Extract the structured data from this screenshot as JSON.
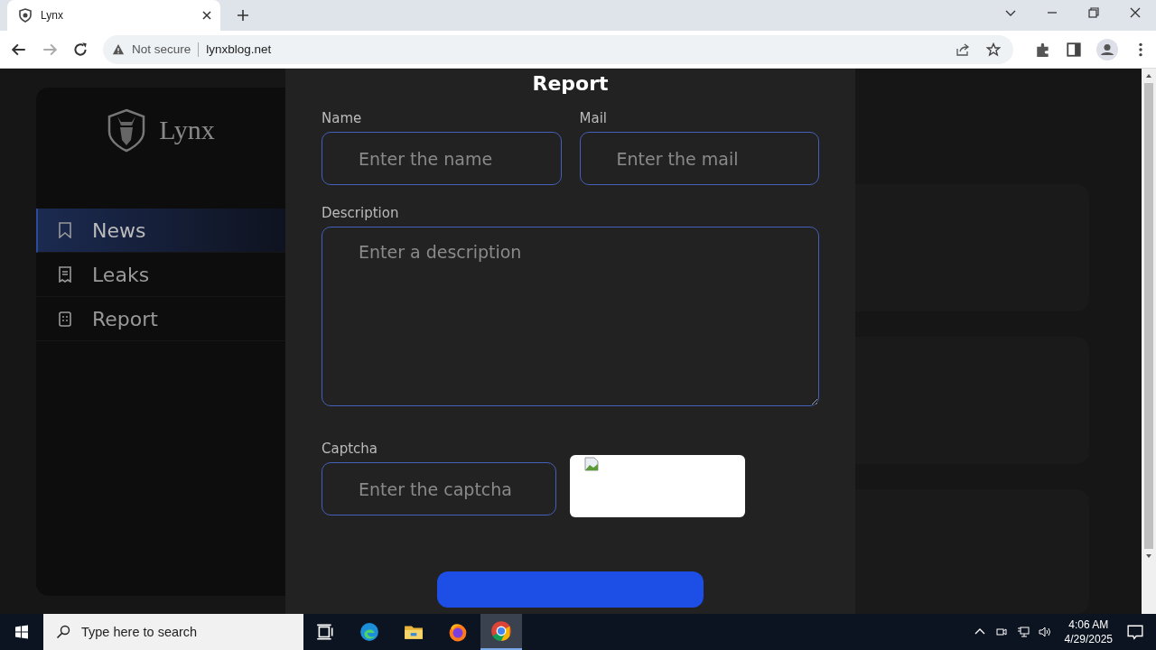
{
  "browser": {
    "tab": {
      "title": "Lynx"
    },
    "address": {
      "security": "Not secure",
      "url": "lynxblog.net"
    }
  },
  "sidebar": {
    "logo": "Lynx",
    "items": [
      {
        "label": "News",
        "selected": true,
        "kind": "bookmark"
      },
      {
        "label": "Leaks",
        "selected": false,
        "kind": "receipt"
      },
      {
        "label": "Report",
        "selected": false,
        "kind": "checklist"
      }
    ]
  },
  "form": {
    "title": "Report",
    "fields": [
      {
        "label": "Name",
        "placeholder": "Enter the name"
      },
      {
        "label": "Mail",
        "placeholder": "Enter the mail"
      }
    ],
    "description": {
      "label": "Description",
      "placeholder": "Enter a description"
    },
    "captcha": {
      "label": "Captcha",
      "placeholder": "Enter the captcha"
    }
  },
  "taskbar": {
    "search_placeholder": "Type here to search",
    "time": "4:06 AM",
    "date": "4/29/2025"
  }
}
